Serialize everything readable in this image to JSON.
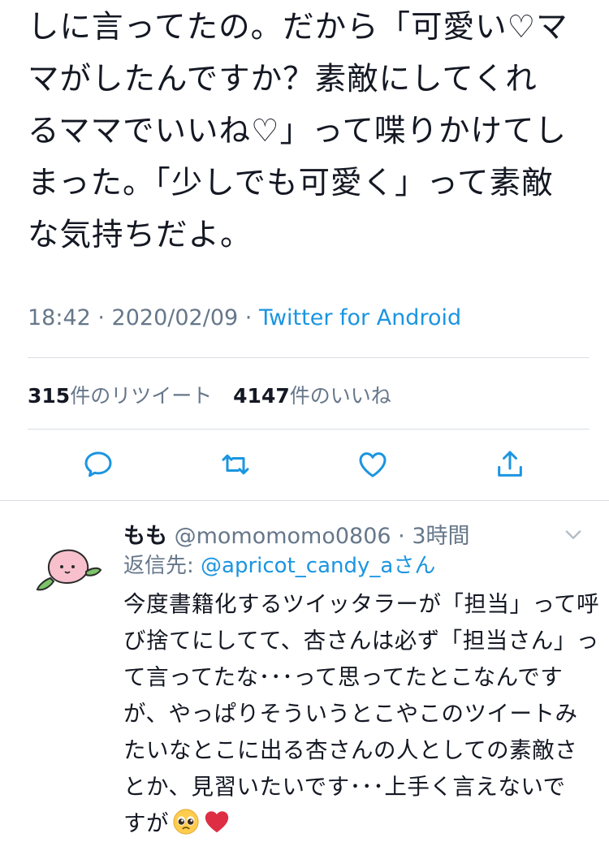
{
  "tweet": {
    "lines": [
      "しに言ってたの。だから「可愛い♡マ",
      "マがしたんですか？素敵にしてくれ",
      "るママでいいね♡」って喋りかけてし",
      "まった。「少しでも可愛く」って素敵",
      "な気持ちだよ。"
    ],
    "time": "18:42 · 2020/02/09 · ",
    "client": "Twitter for Android"
  },
  "stats": {
    "retweets_count": "315",
    "retweets_label": "件のリツイート",
    "likes_count": "4147",
    "likes_label": "件のいいね"
  },
  "actions": {
    "reply_icon": "speech-bubble-icon",
    "retweet_icon": "retweet-arrows-icon",
    "like_icon": "heart-outline-icon",
    "share_icon": "share-upload-icon"
  },
  "reply": {
    "name": "もも",
    "handle": " @momomomo0806",
    "time": " · 3時間",
    "replying_prefix": "返信先: ",
    "replying_mention": "@apricot_candy_a",
    "replying_suffix": "さん",
    "lines": [
      "今度書籍化するツイッタラーが「担当」って呼",
      "び捨てにしてて、杏さんは必ず「担当さん」っ",
      "て言ってたな･･･って思ってたとこなんです",
      "が、やっぱりそういうとこやこのツイートみ",
      "たいなとこに出る杏さんの人としての素敵さ",
      "とか、見習いたいです･･･上手く言えないで",
      "すが"
    ]
  },
  "colors": {
    "text": "#141823",
    "muted": "#66778a",
    "link": "#1b95e0",
    "divider": "#d9dee3",
    "icon": "#1b95e0"
  }
}
